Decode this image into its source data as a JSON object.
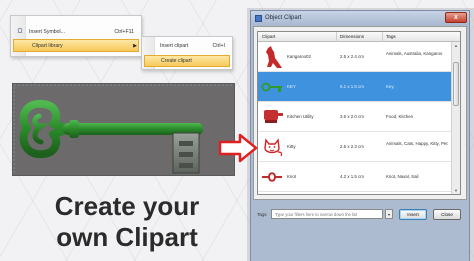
{
  "menu": {
    "items": [
      {
        "label": "Insert Symbol...",
        "shortcut": "Ctrl+F11"
      },
      {
        "label": "Clipart library",
        "arrow": "▶"
      }
    ],
    "submenu": [
      {
        "label": "Insert clipart",
        "shortcut": "Ctrl+I"
      },
      {
        "label": "Create clipart"
      }
    ]
  },
  "caption": {
    "line1": "Create your",
    "line2": "own Clipart"
  },
  "dialog": {
    "title": "Object Clipart",
    "close": "x",
    "columns": [
      "Clipart",
      "Dimensions",
      "Tags"
    ],
    "rows": [
      {
        "name": "Kangaroo02",
        "dims": "2.5 x 2.4 cm",
        "tags": "Animals, Australia, Kangaroo",
        "icon": "kangaroo-icon"
      },
      {
        "name": "KEY",
        "dims": "5.1 x 1.5 cm",
        "tags": "Key,",
        "icon": "key-icon",
        "selected": true
      },
      {
        "name": "Kitchen Utility",
        "dims": "3.6 x 2.0 cm",
        "tags": "Food, Kitchen",
        "icon": "kitchen-utility-icon"
      },
      {
        "name": "Kitty",
        "dims": "2.5 x 2.3 cm",
        "tags": "Animals, Cats, Happy, Kitty, Pet",
        "icon": "kitty-icon"
      },
      {
        "name": "Knot",
        "dims": "4.2 x 1.5 cm",
        "tags": "Knot, Naval, Sail",
        "icon": "knot-icon"
      }
    ],
    "filter_label": "Tags:",
    "filter_placeholder": "Type your filters here to narrow down the list",
    "insert_label": "Insert",
    "close_label": "Close"
  },
  "colors": {
    "accent": "#3f92de",
    "menu_highlight": "#f7c95a",
    "arrow": "#e02020",
    "key": "#2e8a2e"
  }
}
